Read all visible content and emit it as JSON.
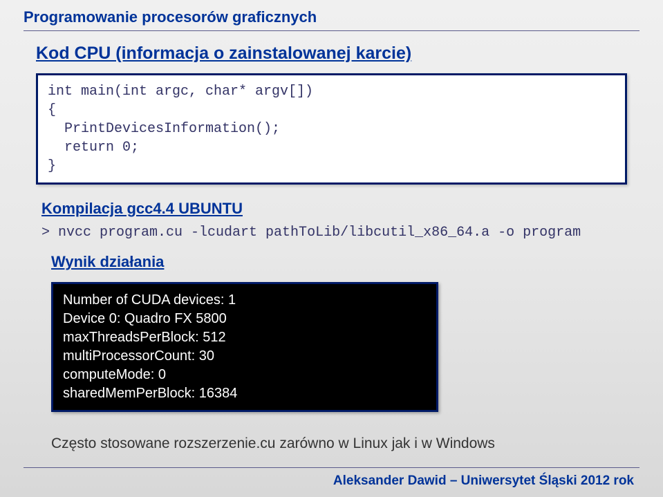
{
  "header": {
    "title": "Programowanie procesorów graficznych"
  },
  "section1": {
    "title": "Kod CPU (informacja o zainstalowanej karcie)",
    "code": "int main(int argc, char* argv[])\n{\n  PrintDevicesInformation();\n  return 0;\n}"
  },
  "compile": {
    "title": "Kompilacja gcc4.4 UBUNTU",
    "cmd": "> nvcc program.cu -lcudart pathToLib/libcutil_x86_64.a -o program"
  },
  "result": {
    "title": "Wynik działania",
    "lines": {
      "l0": "Number of CUDA devices: 1",
      "l1": "Device 0: Quadro FX 5800",
      "l2": "maxThreadsPerBlock: 512",
      "l3": "multiProcessorCount: 30",
      "l4": "computeMode: 0",
      "l5": "sharedMemPerBlock: 16384"
    }
  },
  "note": "Często stosowane rozszerzenie.cu zarówno w Linux jak i w Windows",
  "footer": "Aleksander Dawid – Uniwersytet Śląski 2012 rok"
}
